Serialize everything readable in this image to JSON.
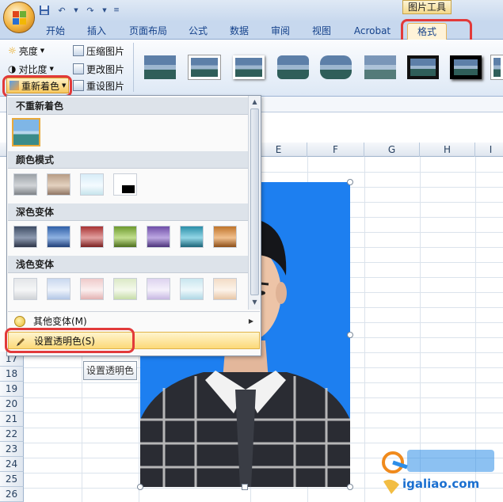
{
  "title_bar": {
    "picture_tools_label": "图片工具"
  },
  "tabs": [
    {
      "label": "开始"
    },
    {
      "label": "插入"
    },
    {
      "label": "页面布局"
    },
    {
      "label": "公式"
    },
    {
      "label": "数据"
    },
    {
      "label": "审阅"
    },
    {
      "label": "视图"
    },
    {
      "label": "Acrobat"
    },
    {
      "label": "格式"
    }
  ],
  "adjust_group": {
    "brightness": "亮度",
    "contrast": "对比度",
    "recolor": "重新着色",
    "compress": "压缩图片",
    "change": "更改图片",
    "reset": "重设图片"
  },
  "columns": [
    "E",
    "F",
    "G",
    "H",
    "I"
  ],
  "rows": [
    "17",
    "18",
    "19",
    "20",
    "21",
    "22",
    "23",
    "24",
    "25",
    "26"
  ],
  "recolor_menu": {
    "section_none": "不重新着色",
    "section_color_modes": "颜色模式",
    "section_dark": "深色变体",
    "section_light": "浅色变体",
    "more_variations": "其他变体(M)",
    "set_transparent": "设置透明色(S)"
  },
  "tooltip": "设置透明色",
  "colors": {
    "photo_background": "#1d7ff0",
    "highlight_ring": "#e23a3a",
    "menu_highlight": "#fcd978"
  },
  "watermark": {
    "site_text": "igaliao.com"
  }
}
